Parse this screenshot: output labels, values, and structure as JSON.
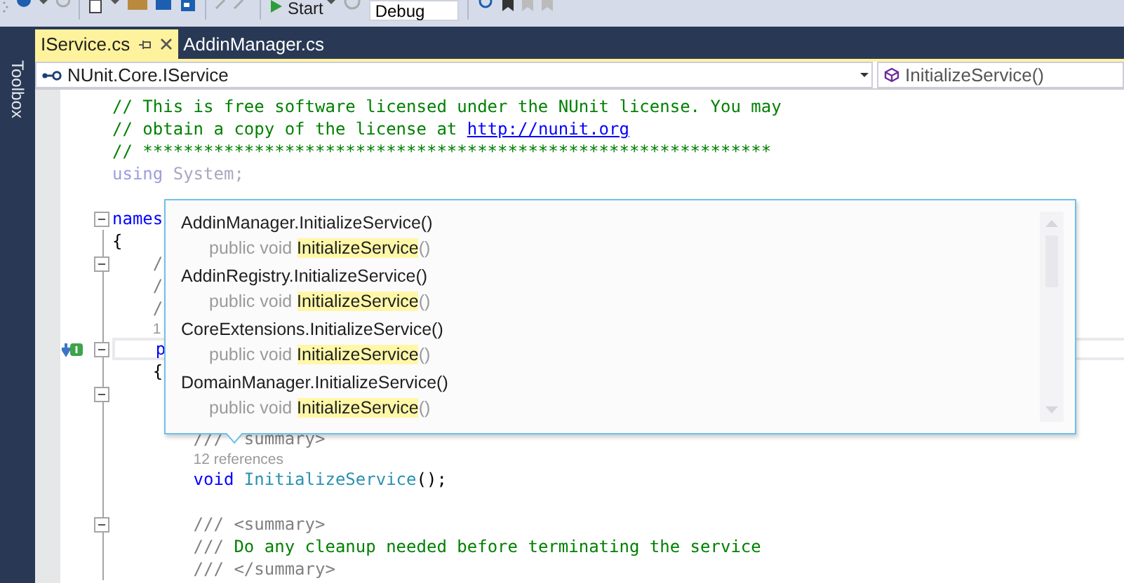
{
  "toolbar": {
    "run_label": "Start",
    "configuration": "Debug"
  },
  "sidebar": {
    "label": "Toolbox"
  },
  "tabs": [
    {
      "label": "IService.cs",
      "selected": true
    },
    {
      "label": "AddinManager.cs",
      "selected": false
    }
  ],
  "navigation": {
    "type_dropdown": "NUnit.Core.IService",
    "member_dropdown": "InitializeService()"
  },
  "editor": {
    "lines": [
      {
        "kind": "code",
        "segments": [
          {
            "kind": "comment",
            "text": "// This is free software licensed under the NUnit license. You may"
          }
        ]
      },
      {
        "kind": "code",
        "segments": [
          {
            "kind": "comment",
            "text": "// obtain a copy of the license at "
          },
          {
            "kind": "link",
            "text": "http://nunit.org"
          }
        ]
      },
      {
        "kind": "code",
        "segments": [
          {
            "kind": "comment",
            "text": "// **************************************************************"
          }
        ]
      },
      {
        "kind": "code",
        "segments": [
          {
            "kind": "faded_keyword",
            "text": "using"
          },
          {
            "kind": "faded",
            "text": " System;"
          }
        ]
      },
      {
        "kind": "code"
      },
      {
        "kind": "code",
        "fold": true,
        "segments": [
          {
            "kind": "keyword",
            "text": "names"
          }
        ]
      },
      {
        "kind": "code",
        "segments": [
          {
            "kind": "plain",
            "text": "{"
          }
        ]
      },
      {
        "kind": "code",
        "fold": true,
        "in_namespace": true,
        "segments": [
          {
            "kind": "doc",
            "text": "/"
          }
        ]
      },
      {
        "kind": "code",
        "in_namespace": true,
        "segments": [
          {
            "kind": "doc",
            "text": "/"
          }
        ]
      },
      {
        "kind": "code",
        "in_namespace": true,
        "segments": [
          {
            "kind": "doc",
            "text": "/"
          }
        ]
      },
      {
        "kind": "lens",
        "in_namespace": true,
        "segments": [
          {
            "kind": "lens",
            "text": "1"
          }
        ]
      },
      {
        "kind": "code",
        "fold": true,
        "current": true,
        "implemented": true,
        "in_namespace": true,
        "segments": [
          {
            "kind": "keyword",
            "text": "p"
          }
        ]
      },
      {
        "kind": "code",
        "in_namespace": true,
        "segments": [
          {
            "kind": "plain",
            "text": "{"
          }
        ]
      },
      {
        "kind": "code",
        "fold": true
      },
      {
        "kind": "code"
      },
      {
        "kind": "covered",
        "in_namespace": true,
        "in_interface": true,
        "segments": [
          {
            "kind": "doc",
            "text": "///"
          },
          {
            "kind": "doc",
            "text": "summary>"
          }
        ]
      },
      {
        "kind": "lens",
        "in_namespace": true,
        "in_interface": true,
        "segments": [
          {
            "kind": "lens",
            "text": "12 references"
          }
        ]
      },
      {
        "kind": "code",
        "in_namespace": true,
        "in_interface": true,
        "segments": [
          {
            "kind": "keyword",
            "text": "void "
          },
          {
            "kind": "type",
            "text": "InitializeService"
          },
          {
            "kind": "plain",
            "text": "();"
          }
        ]
      },
      {
        "kind": "code"
      },
      {
        "kind": "code",
        "fold": true,
        "in_namespace": true,
        "in_interface": true,
        "segments": [
          {
            "kind": "doc",
            "text": "/// <summary>"
          }
        ]
      },
      {
        "kind": "code",
        "in_namespace": true,
        "in_interface": true,
        "segments": [
          {
            "kind": "doc",
            "text": "/// "
          },
          {
            "kind": "comment",
            "text": "Do any cleanup needed before terminating the service"
          }
        ]
      },
      {
        "kind": "code",
        "in_namespace": true,
        "in_interface": true,
        "segments": [
          {
            "kind": "doc",
            "text": "/// </summary>"
          }
        ]
      }
    ]
  },
  "references_popup": {
    "items": [
      {
        "title": "AddinManager.InitializeService()",
        "signature_prefix": "public void ",
        "match": "InitializeService",
        "signature_suffix": "()"
      },
      {
        "title": "AddinRegistry.InitializeService()",
        "signature_prefix": "public void ",
        "match": "InitializeService",
        "signature_suffix": "()"
      },
      {
        "title": "CoreExtensions.InitializeService()",
        "signature_prefix": "public void ",
        "match": "InitializeService",
        "signature_suffix": "()"
      },
      {
        "title": "DomainManager.InitializeService()",
        "signature_prefix": "public void ",
        "match": "InitializeService",
        "signature_suffix": "()"
      }
    ]
  }
}
